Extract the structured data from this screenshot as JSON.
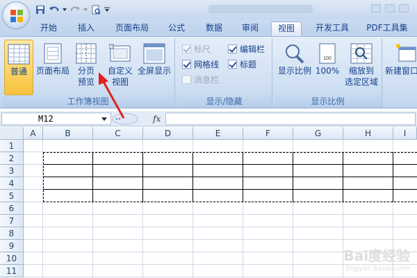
{
  "tabs": [
    "开始",
    "插入",
    "页面布局",
    "公式",
    "数据",
    "审阅",
    "视图",
    "开发工具",
    "PDF工具集"
  ],
  "active_tab": "视图",
  "ribbon": {
    "workbook_views": {
      "label": "工作簿视图",
      "buttons": [
        {
          "id": "normal",
          "line1": "普通",
          "line2": "",
          "active": true,
          "icon": "normal-view-icon"
        },
        {
          "id": "page_layout",
          "line1": "页面布局",
          "line2": "",
          "active": false,
          "icon": "page-layout-icon"
        },
        {
          "id": "page_break",
          "line1": "分页",
          "line2": "预览",
          "active": false,
          "icon": "page-break-preview-icon"
        },
        {
          "id": "custom",
          "line1": "自定义",
          "line2": "视图",
          "active": false,
          "icon": "custom-view-icon"
        },
        {
          "id": "fullscreen",
          "line1": "全屏显示",
          "line2": "",
          "active": false,
          "icon": "fullscreen-icon"
        }
      ]
    },
    "show_hide": {
      "label": "显示/隐藏",
      "checks": [
        {
          "id": "ruler",
          "text": "标尺",
          "checked": true,
          "disabled": true
        },
        {
          "id": "formula_bar",
          "text": "编辑栏",
          "checked": true,
          "disabled": false
        },
        {
          "id": "gridlines",
          "text": "网格线",
          "checked": true,
          "disabled": false
        },
        {
          "id": "headings",
          "text": "标题",
          "checked": true,
          "disabled": false
        },
        {
          "id": "message_bar",
          "text": "消息栏",
          "checked": false,
          "disabled": true
        }
      ]
    },
    "zoom": {
      "label": "显示比例",
      "buttons": [
        {
          "id": "zoom",
          "line1": "显示比例",
          "line2": "",
          "icon": "zoom-icon"
        },
        {
          "id": "zoom100",
          "line1": "100%",
          "line2": "",
          "icon": "zoom-100-icon"
        },
        {
          "id": "zoom_selection",
          "line1": "缩放到",
          "line2": "选定区域",
          "icon": "zoom-selection-icon"
        }
      ]
    },
    "window": {
      "buttons": [
        {
          "id": "new_window",
          "line1": "新建窗口",
          "line2": "",
          "icon": "new-window-icon"
        }
      ]
    }
  },
  "formula_bar": {
    "name_box": "M12",
    "fx": "fx",
    "formula": ""
  },
  "columns": [
    "A",
    "B",
    "C",
    "D",
    "E",
    "F",
    "G",
    "H",
    "I"
  ],
  "rows": [
    "1",
    "2",
    "3",
    "4",
    "5",
    "6",
    "7",
    "8",
    "9",
    "10",
    "11"
  ],
  "watermark": {
    "text": "Bai度经验",
    "sub": "jingyan.baidu.com"
  }
}
